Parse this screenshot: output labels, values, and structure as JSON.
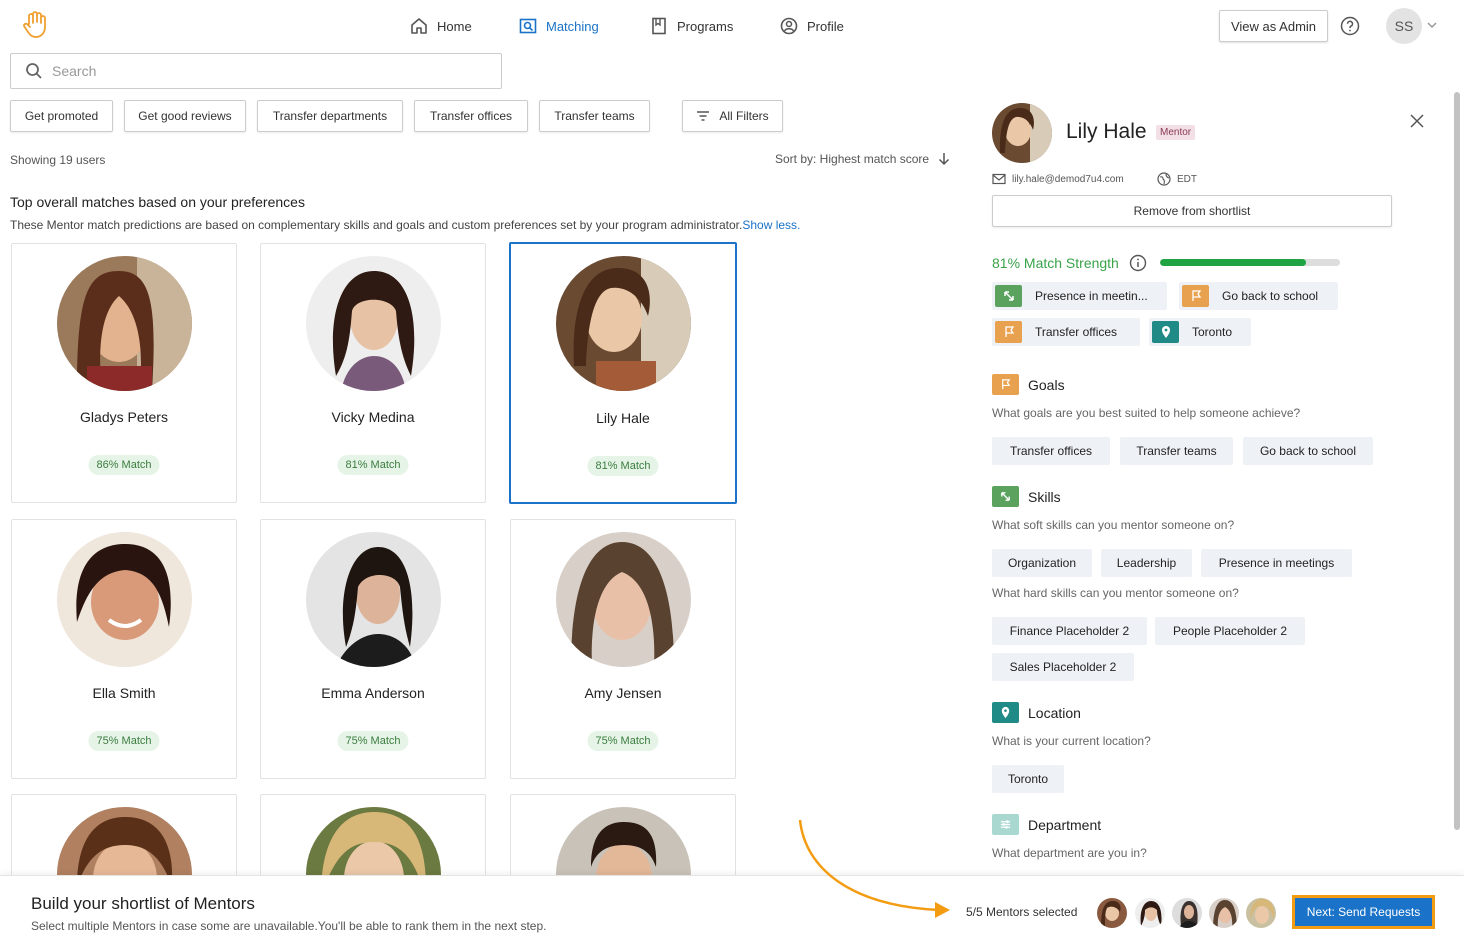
{
  "nav": {
    "items": [
      {
        "label": "Home",
        "icon": "home-icon"
      },
      {
        "label": "Matching",
        "icon": "matching-icon",
        "active": true
      },
      {
        "label": "Programs",
        "icon": "book-icon"
      },
      {
        "label": "Profile",
        "icon": "profile-icon"
      }
    ],
    "admin_label": "View as Admin",
    "user_initials": "SS"
  },
  "search": {
    "placeholder": "Search",
    "value": ""
  },
  "filters": [
    "Get promoted",
    "Get good reviews",
    "Transfer departments",
    "Transfer offices",
    "Transfer teams",
    "All Filters"
  ],
  "results": {
    "showing": "Showing 19 users",
    "sort": "Sort by: Highest match score",
    "title": "Top overall matches based on your preferences",
    "description": "These Mentor match predictions are based on complementary skills and goals and custom preferences set by your program administrator.",
    "show_less": "Show less."
  },
  "cards": [
    {
      "name": "Gladys Peters",
      "match": "86% Match"
    },
    {
      "name": "Vicky Medina",
      "match": "81% Match"
    },
    {
      "name": "Lily Hale",
      "match": "81% Match",
      "selected": true
    },
    {
      "name": "Ella Smith",
      "match": "75% Match"
    },
    {
      "name": "Emma Anderson",
      "match": "75% Match"
    },
    {
      "name": "Amy Jensen",
      "match": "75% Match"
    },
    {
      "name": "",
      "match": ""
    },
    {
      "name": "",
      "match": ""
    },
    {
      "name": "",
      "match": ""
    }
  ],
  "panel": {
    "name": "Lily Hale",
    "role": "Mentor",
    "email": "lily.hale@demod7u4.com",
    "timezone": "EDT",
    "remove_label": "Remove from shortlist",
    "strength_label": "81% Match Strength",
    "strength_value": 0.81,
    "match_tags": [
      {
        "label": "Presence in meetin...",
        "icon": "skill-icon"
      },
      {
        "label": "Go back to school",
        "icon": "flag-icon"
      },
      {
        "label": "Transfer offices",
        "icon": "flag-icon"
      },
      {
        "label": "Toronto",
        "icon": "location-icon"
      }
    ],
    "goals": {
      "title": "Goals",
      "question": "What goals are you best suited to help someone achieve?",
      "items": [
        "Transfer offices",
        "Transfer teams",
        "Go back to school"
      ]
    },
    "skills": {
      "title": "Skills",
      "soft_question": "What soft skills can you mentor someone on?",
      "soft": [
        "Organization",
        "Leadership",
        "Presence in meetings"
      ],
      "hard_question": "What hard skills can you mentor someone on?",
      "hard": [
        "Finance Placeholder 2",
        "People Placeholder 2",
        "Sales Placeholder 2"
      ]
    },
    "location": {
      "title": "Location",
      "question": "What is your current location?",
      "items": [
        "Toronto"
      ]
    },
    "department": {
      "title": "Department",
      "question": "What department are you in?"
    }
  },
  "shortlist": {
    "title": "Build your shortlist of Mentors",
    "subtitle": "Select multiple Mentors in case some are unavailable.You'll be able to rank them in the next step.",
    "count": "5/5 Mentors selected",
    "send_label": "Next: Send Requests"
  },
  "colors": {
    "accent": "#1a73c8",
    "match_green": "#3aa34a",
    "goal_orange": "#e8a24f",
    "skill_green": "#5aa25e",
    "location_teal": "#1f8a86",
    "dept_mint": "#a8d8d0",
    "callout_orange": "#f39c12"
  }
}
